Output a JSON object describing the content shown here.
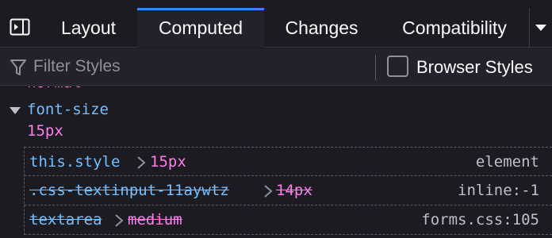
{
  "tabs": {
    "sidebar_toggle_icon": "sidebar-toggle-icon",
    "items": [
      {
        "label": "Layout"
      },
      {
        "label": "Computed",
        "selected": true
      },
      {
        "label": "Changes"
      },
      {
        "label": "Compatibility"
      }
    ],
    "menu_icon": "chevron-down-icon",
    "accent_color": "#3b82f6"
  },
  "filter": {
    "icon": "filter-icon",
    "placeholder": "Filter Styles",
    "value": "",
    "browser_styles_label": "Browser Styles",
    "browser_styles_checked": false
  },
  "computed": {
    "previous_value_cut": "normal",
    "property": {
      "name": "font-size",
      "value": "15px",
      "expanded": true
    },
    "rules": [
      {
        "selector": "this.style",
        "value": "15px",
        "source": "element",
        "overridden": false
      },
      {
        "selector": ".css-textinput-11aywtz",
        "value": "14px",
        "source": "inline:-1",
        "overridden": true
      },
      {
        "selector": "textarea",
        "value": "medium",
        "source": "forms.css:105",
        "overridden": true
      }
    ]
  },
  "colors": {
    "property_name": "#75bfff",
    "property_value": "#ff7de9",
    "background": "#1c1b22"
  }
}
